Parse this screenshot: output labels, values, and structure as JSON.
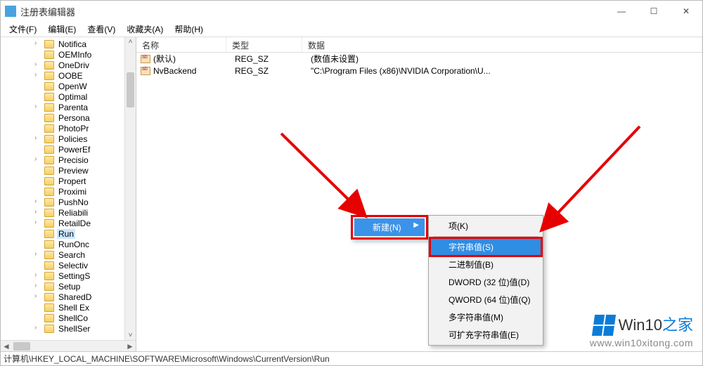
{
  "title": "注册表编辑器",
  "window_controls": {
    "min": "—",
    "max": "☐",
    "close": "✕"
  },
  "menubar": [
    "文件(F)",
    "编辑(E)",
    "查看(V)",
    "收藏夹(A)",
    "帮助(H)"
  ],
  "tree": {
    "items": [
      {
        "name": "Notifica",
        "expandable": true
      },
      {
        "name": "OEMInfo"
      },
      {
        "name": "OneDriv",
        "expandable": true
      },
      {
        "name": "OOBE",
        "expandable": true
      },
      {
        "name": "OpenW"
      },
      {
        "name": "Optimal"
      },
      {
        "name": "Parenta",
        "expandable": true
      },
      {
        "name": "Persona"
      },
      {
        "name": "PhotoPr"
      },
      {
        "name": "Policies",
        "expandable": true
      },
      {
        "name": "PowerEf"
      },
      {
        "name": "Precisio",
        "expandable": true
      },
      {
        "name": "Preview"
      },
      {
        "name": "Propert"
      },
      {
        "name": "Proximi"
      },
      {
        "name": "PushNo",
        "expandable": true
      },
      {
        "name": "Reliabili",
        "expandable": true
      },
      {
        "name": "RetailDe",
        "expandable": true
      },
      {
        "name": "Run",
        "selected": true
      },
      {
        "name": "RunOnc"
      },
      {
        "name": "Search",
        "expandable": true
      },
      {
        "name": "Selectiv"
      },
      {
        "name": "SettingS",
        "expandable": true
      },
      {
        "name": "Setup",
        "expandable": true
      },
      {
        "name": "SharedD",
        "expandable": true
      },
      {
        "name": "Shell Ex"
      },
      {
        "name": "ShellCo"
      },
      {
        "name": "ShellSer",
        "expandable": true
      }
    ]
  },
  "list": {
    "headers": {
      "name": "名称",
      "type": "类型",
      "data": "数据"
    },
    "rows": [
      {
        "name": "(默认)",
        "type": "REG_SZ",
        "data": "(数值未设置)"
      },
      {
        "name": "NvBackend",
        "type": "REG_SZ",
        "data": "\"C:\\Program Files (x86)\\NVIDIA Corporation\\U..."
      }
    ]
  },
  "context_menu_1": {
    "label": "新建(N)"
  },
  "context_menu_2": {
    "items": [
      {
        "label": "项(K)"
      },
      {
        "label": "字符串值(S)",
        "highlight": true
      },
      {
        "label": "二进制值(B)"
      },
      {
        "label": "DWORD (32 位)值(D)"
      },
      {
        "label": "QWORD (64 位)值(Q)"
      },
      {
        "label": "多字符串值(M)"
      },
      {
        "label": "可扩充字符串值(E)"
      }
    ]
  },
  "statusbar": "计算机\\HKEY_LOCAL_MACHINE\\SOFTWARE\\Microsoft\\Windows\\CurrentVersion\\Run",
  "watermark": {
    "brand_main": "Win10",
    "brand_accent": "之家",
    "url": "www.win10xitong.com"
  }
}
